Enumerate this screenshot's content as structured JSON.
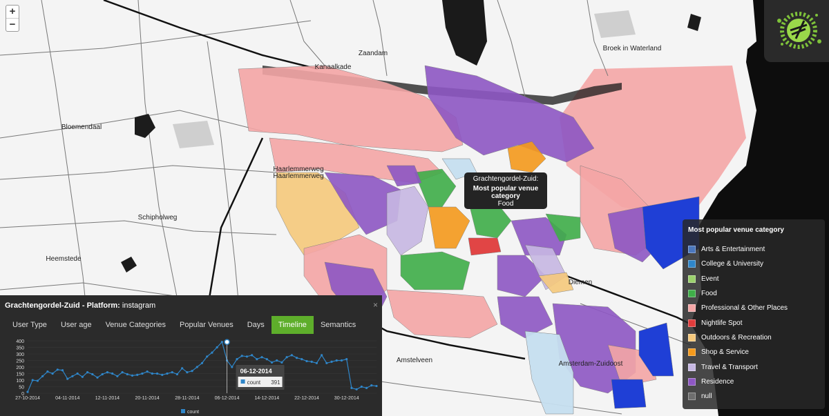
{
  "map": {
    "places": [
      {
        "name": "Zaandam",
        "x": 540,
        "y": 80
      },
      {
        "name": "Broek in Waterland",
        "x": 915,
        "y": 73
      },
      {
        "name": "Bloemendaal",
        "x": 118,
        "y": 187
      },
      {
        "name": "Heemstede",
        "x": 92,
        "y": 378
      },
      {
        "name": "Diemen",
        "x": 840,
        "y": 412
      },
      {
        "name": "Amstelveen",
        "x": 600,
        "y": 525
      },
      {
        "name": "Amsterdam-Zuidoost",
        "x": 855,
        "y": 530
      },
      {
        "name": "Kanaalkade",
        "x": 482,
        "y": 100
      },
      {
        "name": "Haarlemmerweg",
        "x": 432,
        "y": 248
      },
      {
        "name": "Haarlemmerweg",
        "x": 432,
        "y": 258
      },
      {
        "name": "Schipholweg",
        "x": 228,
        "y": 318
      }
    ]
  },
  "zoom": {
    "in": "+",
    "out": "−"
  },
  "tooltip": {
    "area": "Grachtengordel-Zuid:",
    "heading": "Most popular venue category",
    "value": "Food"
  },
  "legend": {
    "title": "Most popular venue category",
    "items": [
      {
        "label": "Arts & Entertainment",
        "color": "#4b77be"
      },
      {
        "label": "College & University",
        "color": "#2f86c9"
      },
      {
        "label": "Event",
        "color": "#9bd16c"
      },
      {
        "label": "Food",
        "color": "#3fae49"
      },
      {
        "label": "Professional & Other Places",
        "color": "#f4a6a6"
      },
      {
        "label": "Nightlife Spot",
        "color": "#e03c3c"
      },
      {
        "label": "Outdoors & Recreation",
        "color": "#f6c97c"
      },
      {
        "label": "Shop & Service",
        "color": "#f59a1c"
      },
      {
        "label": "Travel & Transport",
        "color": "#c7b8e3"
      },
      {
        "label": "Residence",
        "color": "#8e57c4"
      },
      {
        "label": "null",
        "color": "#6e6e6e"
      }
    ]
  },
  "panel": {
    "area": "Grachtengordel-Zuid",
    "platform_label": "- Platform:",
    "platform": "instagram",
    "close": "×",
    "tabs": [
      "User Type",
      "User age",
      "Venue Categories",
      "Popular Venues",
      "Days",
      "Timeline",
      "Semantics"
    ],
    "active_tab": "Timeline"
  },
  "chart_data": {
    "type": "line",
    "x": [
      "27-10-2014",
      "28-10-2014",
      "29-10-2014",
      "30-10-2014",
      "31-10-2014",
      "01-11-2014",
      "02-11-2014",
      "03-11-2014",
      "04-11-2014",
      "05-11-2014",
      "06-11-2014",
      "07-11-2014",
      "08-11-2014",
      "09-11-2014",
      "10-11-2014",
      "11-11-2014",
      "12-11-2014",
      "13-11-2014",
      "14-11-2014",
      "15-11-2014",
      "16-11-2014",
      "17-11-2014",
      "18-11-2014",
      "19-11-2014",
      "20-11-2014",
      "21-11-2014",
      "22-11-2014",
      "23-11-2014",
      "24-11-2014",
      "25-11-2014",
      "26-11-2014",
      "27-11-2014",
      "28-11-2014",
      "29-11-2014",
      "30-11-2014",
      "01-12-2014",
      "02-12-2014",
      "03-12-2014",
      "04-12-2014",
      "05-12-2014",
      "06-12-2014",
      "07-12-2014",
      "08-12-2014",
      "09-12-2014",
      "10-12-2014",
      "11-12-2014",
      "12-12-2014",
      "13-12-2014",
      "14-12-2014",
      "15-12-2014",
      "16-12-2014",
      "17-12-2014",
      "18-12-2014",
      "19-12-2014",
      "20-12-2014",
      "21-12-2014",
      "22-12-2014",
      "23-12-2014",
      "24-12-2014",
      "25-12-2014",
      "26-12-2014",
      "27-12-2014",
      "28-12-2014",
      "29-12-2014",
      "30-12-2014",
      "31-12-2014",
      "01-01-2015",
      "02-01-2015",
      "03-01-2015",
      "04-01-2015",
      "05-01-2015"
    ],
    "series": [
      {
        "name": "count",
        "values": [
          10,
          100,
          95,
          130,
          165,
          150,
          180,
          175,
          110,
          130,
          150,
          125,
          160,
          145,
          120,
          145,
          160,
          150,
          130,
          160,
          145,
          135,
          140,
          150,
          165,
          150,
          150,
          140,
          150,
          160,
          145,
          190,
          160,
          170,
          200,
          230,
          280,
          310,
          350,
          391,
          250,
          200,
          260,
          285,
          280,
          290,
          260,
          275,
          260,
          235,
          250,
          235,
          275,
          290,
          270,
          260,
          245,
          240,
          230,
          290,
          230,
          240,
          250,
          250,
          260,
          40,
          30,
          50,
          40,
          60,
          55
        ]
      }
    ],
    "xticks": [
      "27-10-2014",
      "04-11-2014",
      "12-11-2014",
      "20-11-2014",
      "28-11-2014",
      "06-12-2014",
      "14-12-2014",
      "22-12-2014",
      "30-12-2014"
    ],
    "yticks": [
      0,
      50,
      100,
      150,
      200,
      250,
      300,
      350,
      400
    ],
    "ylim": [
      0,
      400
    ],
    "hover": {
      "date": "06-12-2014",
      "label": "count",
      "value": 391
    },
    "legend_label": "count"
  }
}
